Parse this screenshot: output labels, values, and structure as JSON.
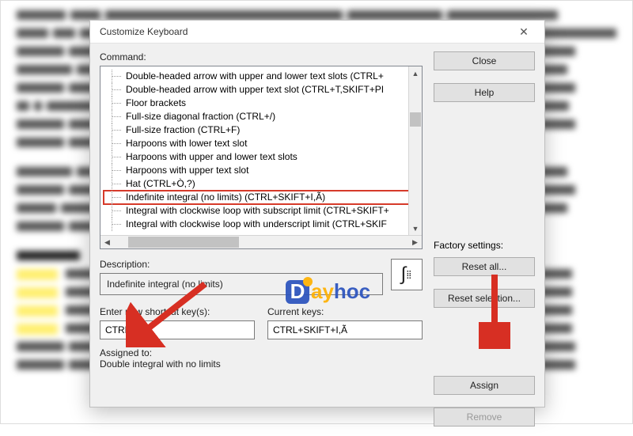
{
  "dialog": {
    "title": "Customize Keyboard",
    "command_label": "Command:",
    "factory_label": "Factory settings:",
    "description_label": "Description:",
    "description_value": "Indefinite integral (no limits)",
    "enter_new_label": "Enter new shortcut key(s):",
    "enter_new_value": "CTRL+P",
    "current_keys_label": "Current keys:",
    "current_keys_value": "CTRL+SKIFT+I,Ã",
    "assigned_to_label": "Assigned to:",
    "assigned_to_value": "Double integral with no limits",
    "buttons": {
      "close": "Close",
      "help": "Help",
      "reset_all": "Reset all...",
      "reset_selection": "Reset selection...",
      "assign": "Assign",
      "remove": "Remove"
    }
  },
  "tree": {
    "selected_index": 9,
    "items": [
      "Double-headed arrow with upper and lower text slots (CTRL+",
      "Double-headed arrow with upper text slot (CTRL+T,SKIFT+PI",
      "Floor brackets",
      "Full-size diagonal fraction (CTRL+/)",
      "Full-size fraction (CTRL+F)",
      "Harpoons with lower text slot",
      "Harpoons with upper and lower text slots",
      "Harpoons with upper text slot",
      "Hat (CTRL+Ò,?)",
      "Indefinite integral (no limits) (CTRL+SKIFT+I,Ã)",
      "Integral with clockwise loop with subscript limit (CTRL+SKIFT+",
      "Integral with clockwise loop with underscript limit (CTRL+SKIF"
    ]
  },
  "watermark": {
    "text_a": "ay",
    "text_b": "hoc"
  }
}
